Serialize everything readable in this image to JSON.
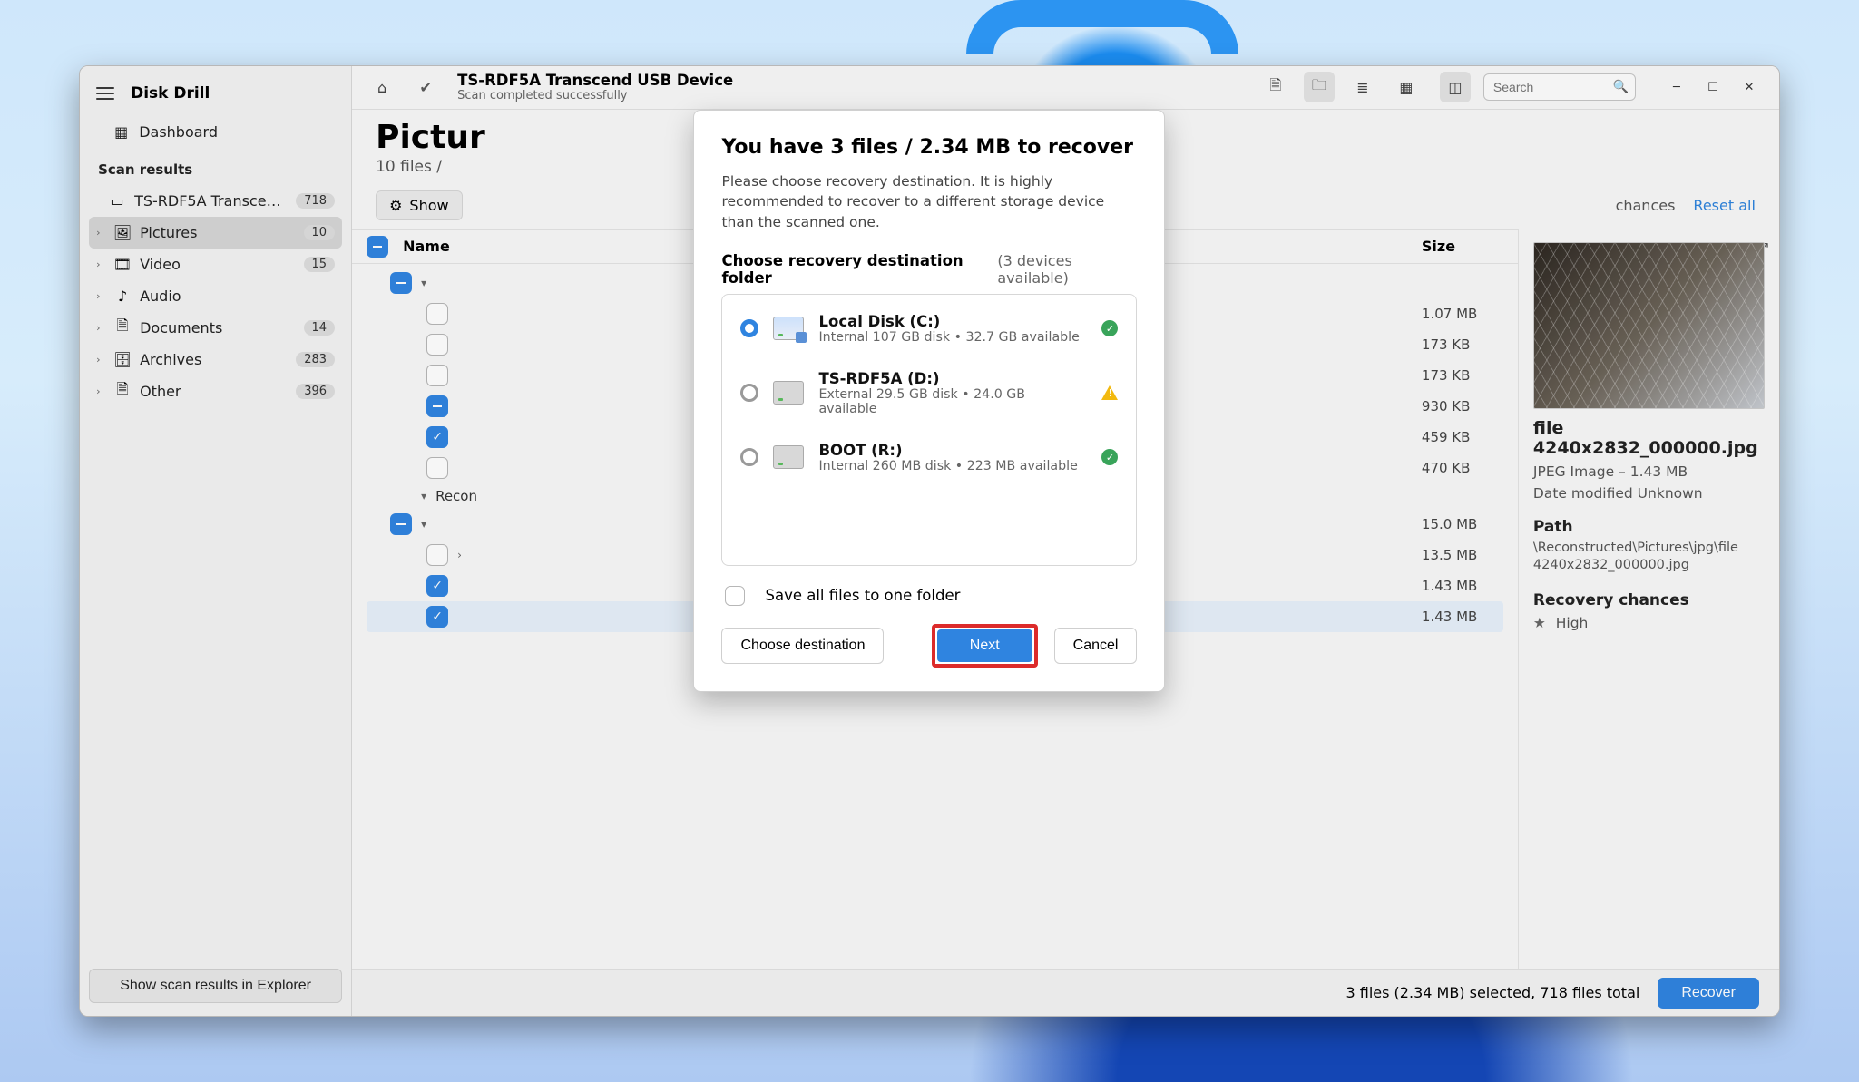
{
  "app_name": "Disk Drill",
  "sidebar": {
    "dashboard": "Dashboard",
    "section": "Scan results",
    "device": {
      "label": "TS-RDF5A Transcend US...",
      "count": "718"
    },
    "categories": [
      {
        "label": "Pictures",
        "count": "10",
        "active": true
      },
      {
        "label": "Video",
        "count": "15",
        "active": false
      },
      {
        "label": "Audio",
        "count": "",
        "active": false
      },
      {
        "label": "Documents",
        "count": "14",
        "active": false
      },
      {
        "label": "Archives",
        "count": "283",
        "active": false
      },
      {
        "label": "Other",
        "count": "396",
        "active": false
      }
    ],
    "footer_btn": "Show scan results in Explorer"
  },
  "toolbar": {
    "device": "TS-RDF5A Transcend USB Device",
    "status": "Scan completed successfully",
    "search_placeholder": "Search"
  },
  "page": {
    "title": "Pictur",
    "subtitle": "10 files /",
    "show_label": "Show",
    "chances_label": "chances",
    "reset": "Reset all"
  },
  "table": {
    "name_header": "Name",
    "size_header": "Size",
    "rows": [
      {
        "cb": "mixed",
        "chev": "▾",
        "label": "",
        "size": "",
        "cls": "indent1"
      },
      {
        "cb": "empty",
        "chev": "",
        "label": "",
        "size": "1.07 MB",
        "cls": "indent2"
      },
      {
        "cb": "empty",
        "chev": "",
        "label": "",
        "size": "173 KB",
        "cls": "indent2"
      },
      {
        "cb": "empty",
        "chev": "",
        "label": "",
        "size": "173 KB",
        "cls": "indent2"
      },
      {
        "cb": "mixed",
        "chev": "",
        "label": "",
        "size": "930 KB",
        "cls": "indent2"
      },
      {
        "cb": "checked",
        "chev": "",
        "label": "",
        "size": "459 KB",
        "cls": "indent2"
      },
      {
        "cb": "empty",
        "chev": "",
        "label": "",
        "size": "470 KB",
        "cls": "indent2"
      },
      {
        "cb": "none",
        "chev": "▾",
        "label": "Recon",
        "size": "",
        "cls": "indent1 group"
      },
      {
        "cb": "mixed",
        "chev": "▾",
        "label": "",
        "size": "15.0 MB",
        "cls": "indent1"
      },
      {
        "cb": "empty",
        "chev": "›",
        "label": "",
        "size": "13.5 MB",
        "cls": "indent2"
      },
      {
        "cb": "checked",
        "chev": "",
        "label": "",
        "size": "1.43 MB",
        "cls": "indent2"
      },
      {
        "cb": "checked",
        "chev": "",
        "label": "",
        "size": "1.43 MB",
        "cls": "indent2 sel"
      }
    ]
  },
  "preview": {
    "file_name": "file 4240x2832_000000.jpg",
    "type_line": "JPEG Image – 1.43 MB",
    "date_line": "Date modified Unknown",
    "path_label": "Path",
    "path_value": "\\Reconstructed\\Pictures\\jpg\\file 4240x2832_000000.jpg",
    "rc_label": "Recovery chances",
    "rc_value": "High"
  },
  "footer": {
    "summary": "3 files (2.34 MB) selected, 718 files total",
    "recover": "Recover"
  },
  "modal": {
    "title": "You have 3 files / 2.34 MB to recover",
    "desc": "Please choose recovery destination. It is highly recommended to recover to a different storage device than the scanned one.",
    "choose_label": "Choose recovery destination folder",
    "avail": "(3 devices available)",
    "destinations": [
      {
        "name": "Local Disk (C:)",
        "sub": "Internal 107 GB disk • 32.7 GB available",
        "selected": true,
        "status": "ok"
      },
      {
        "name": "TS-RDF5A  (D:)",
        "sub": "External 29.5 GB disk • 24.0 GB available",
        "selected": false,
        "status": "warn"
      },
      {
        "name": "BOOT (R:)",
        "sub": "Internal 260 MB disk • 223 MB available",
        "selected": false,
        "status": "ok"
      }
    ],
    "save_one": "Save all files to one folder",
    "choose_btn": "Choose destination",
    "next": "Next",
    "cancel": "Cancel"
  }
}
